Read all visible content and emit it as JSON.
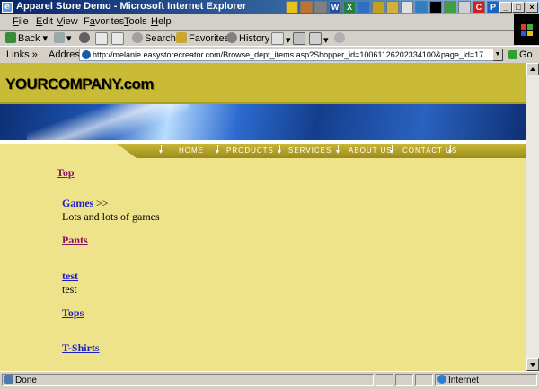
{
  "window": {
    "title": "Apparel Store Demo - Microsoft Internet Explorer"
  },
  "menu": [
    {
      "label": "File",
      "key": "F"
    },
    {
      "label": "Edit",
      "key": "E"
    },
    {
      "label": "View",
      "key": "V"
    },
    {
      "label": "Favorites",
      "key": "a"
    },
    {
      "label": "Tools",
      "key": "T"
    },
    {
      "label": "Help",
      "key": "H"
    }
  ],
  "toolbar": {
    "back": "Back",
    "search": "Search",
    "favorites": "Favorites",
    "history": "History"
  },
  "addressbar": {
    "links_label": "Links",
    "address_label": "Address",
    "url": "http://melanie.easystorecreator.com/Browse_dept_items.asp?Shopper_id=10061126202334100&page_id=17",
    "go_label": "Go"
  },
  "site": {
    "logo": "YOURCOMPANY.com",
    "nav": [
      "HOME",
      "PRODUCTS",
      "SERVICES",
      "ABOUT US",
      "CONTACT US"
    ]
  },
  "content": {
    "top_link": "Top",
    "departments": [
      {
        "name": "Games",
        "suffix": ">>",
        "description": "Lots and lots of games"
      },
      {
        "name": "Pants"
      },
      {
        "name": "test",
        "description": "test"
      },
      {
        "name": "Tops"
      },
      {
        "name": "T-Shirts"
      }
    ]
  },
  "status": {
    "text": "Done",
    "zone": "Internet"
  },
  "colors": {
    "page_bg": "#eee38a",
    "header_gold": "#c9bb36",
    "link": "#1f1fc8",
    "visited_link": "#8a1060"
  }
}
